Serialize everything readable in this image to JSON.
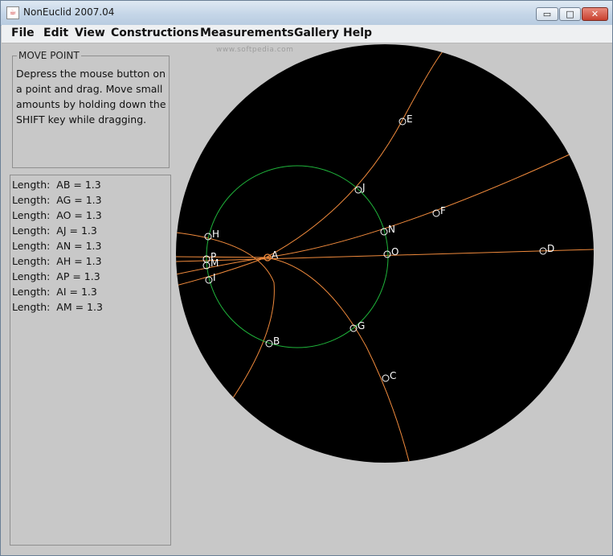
{
  "window": {
    "title": "NonEuclid 2007.04",
    "controls": {
      "minimize": "▭",
      "maximize": "□",
      "close": "✕"
    }
  },
  "menu": [
    "File",
    "Edit",
    "View",
    "Constructions",
    "Measurements",
    "Gallery",
    "Help"
  ],
  "watermark": "www.softpedia.com",
  "mode_panel": {
    "title": "MOVE POINT",
    "instructions": "Depress the mouse button on a point and drag. Move small amounts by holding down the SHIFT key while dragging."
  },
  "measurements": [
    {
      "label": "Length:",
      "value": "AB = 1.3"
    },
    {
      "label": "Length:",
      "value": "AG = 1.3"
    },
    {
      "label": "Length:",
      "value": "AO = 1.3"
    },
    {
      "label": "Length:",
      "value": "AJ = 1.3"
    },
    {
      "label": "Length:",
      "value": "AN = 1.3"
    },
    {
      "label": "Length:",
      "value": "AH = 1.3"
    },
    {
      "label": "Length:",
      "value": "AP = 1.3"
    },
    {
      "label": "Length:",
      "value": "AI = 1.3"
    },
    {
      "label": "Length:",
      "value": "AM = 1.3"
    }
  ],
  "points": [
    {
      "name": "A",
      "selected": true
    },
    {
      "name": "E"
    },
    {
      "name": "J"
    },
    {
      "name": "F"
    },
    {
      "name": "N"
    },
    {
      "name": "O"
    },
    {
      "name": "D"
    },
    {
      "name": "H"
    },
    {
      "name": "P"
    },
    {
      "name": "M"
    },
    {
      "name": "I"
    },
    {
      "name": "G"
    },
    {
      "name": "B"
    },
    {
      "name": "C"
    }
  ],
  "colors": {
    "disk": "#000000",
    "geodesic": "#f08a3c",
    "circle": "#1fb53b",
    "point": "#ffffff",
    "selected_point": "#f08a3c"
  }
}
